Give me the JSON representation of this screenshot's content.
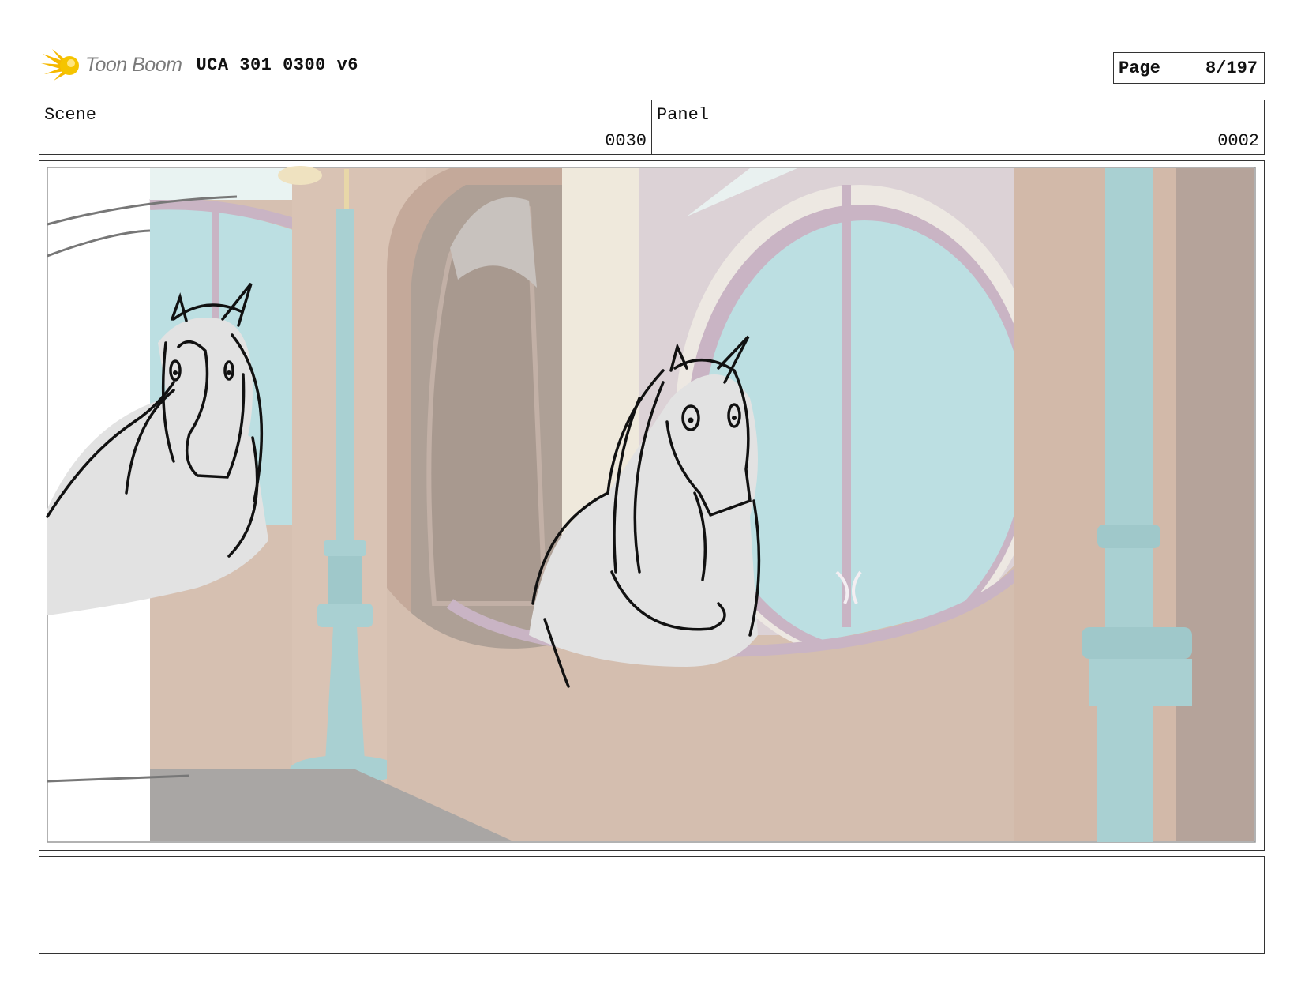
{
  "header": {
    "logo_text": "Toon Boom",
    "title": "UCA 301 0300 v6",
    "page_label": "Page",
    "page_value": "8/197"
  },
  "info": {
    "scene_label": "Scene",
    "scene_value": "0030",
    "panel_label": "Panel",
    "panel_value": "0002"
  },
  "panel": {
    "image_subject": "storyboard-sketch-unicorns"
  },
  "notes": {
    "text": ""
  },
  "colors": {
    "wall": "#d6c0b1",
    "window_glass": "#bcdfe2",
    "window_frame": "#c9b4c4",
    "column": "#a9d0d2",
    "sketch_fill": "#e2e2e2",
    "logo_accent": "#f5b800"
  }
}
